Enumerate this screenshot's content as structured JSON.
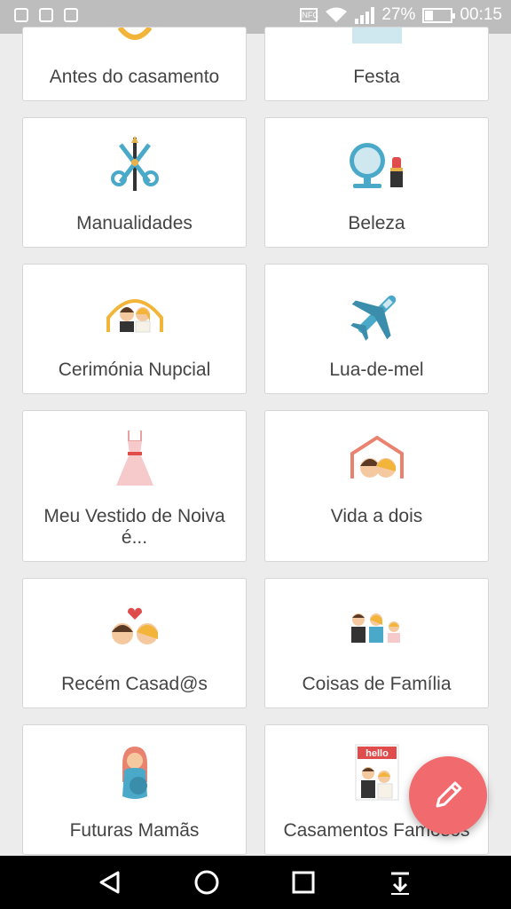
{
  "status_bar": {
    "battery_percent": "27%",
    "time": "00:15",
    "nfc": "NFC"
  },
  "categories": [
    {
      "label": "Antes do casamento",
      "icon": "ring-icon"
    },
    {
      "label": "Festa",
      "icon": "party-icon"
    },
    {
      "label": "Manualidades",
      "icon": "crafts-scissors-icon"
    },
    {
      "label": "Beleza",
      "icon": "mirror-lipstick-icon"
    },
    {
      "label": "Cerimónia Nupcial",
      "icon": "ceremony-couple-icon"
    },
    {
      "label": "Lua-de-mel",
      "icon": "airplane-icon"
    },
    {
      "label": "Meu Vestido de Noiva é...",
      "icon": "wedding-dress-icon"
    },
    {
      "label": "Vida a dois",
      "icon": "couple-house-icon"
    },
    {
      "label": "Recém Casad@s",
      "icon": "couple-heart-icon"
    },
    {
      "label": "Coisas de Família",
      "icon": "family-icon"
    },
    {
      "label": "Futuras Mamãs",
      "icon": "pregnant-mom-icon"
    },
    {
      "label": "Casamentos Famosos",
      "icon": "magazine-hello-icon"
    }
  ],
  "magazine_text": "hello",
  "fab": {
    "icon": "pencil-icon"
  },
  "colors": {
    "fab": "#f06a6e",
    "status_bar": "#bdbdbd",
    "background": "#ececec"
  }
}
